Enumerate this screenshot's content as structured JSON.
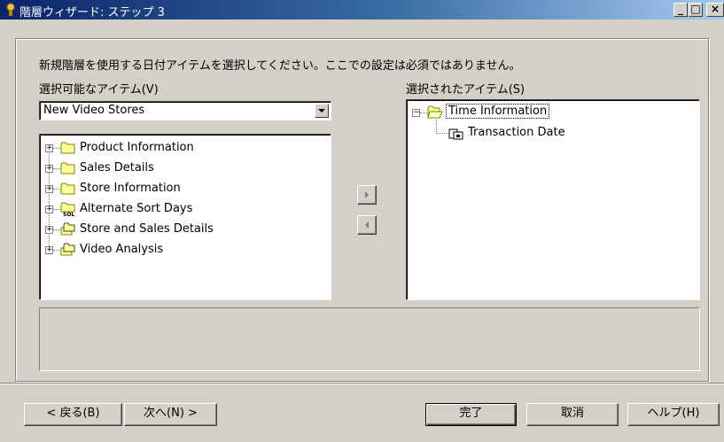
{
  "window": {
    "title": "階層ウィザード: ステップ 3",
    "minimize": "_",
    "maximize": "□",
    "close": "×"
  },
  "instruction": "新規階層を使用する日付アイテムを選択してください。ここでの設定は必須ではありません。",
  "available": {
    "label": "選択可能なアイテム(V)",
    "combo_value": "New Video Stores",
    "items": [
      {
        "label": "Product Information",
        "icon": "folder-icon"
      },
      {
        "label": "Sales Details",
        "icon": "folder-icon"
      },
      {
        "label": "Store Information",
        "icon": "folder-icon"
      },
      {
        "label": "Alternate Sort Days",
        "icon": "sql-folder-icon"
      },
      {
        "label": "Store and Sales Details",
        "icon": "complex-folder-icon"
      },
      {
        "label": "Video Analysis",
        "icon": "complex-folder-icon"
      }
    ]
  },
  "selected": {
    "label": "選択されたアイテム(S)",
    "items": [
      {
        "label": "Time Information",
        "icon": "open-folder-icon"
      },
      {
        "label": "Transaction Date",
        "icon": "date-item-icon"
      }
    ]
  },
  "buttons": {
    "back": "< 戻る(B)",
    "next": "次へ(N) >",
    "finish": "完了",
    "cancel": "取消",
    "help": "ヘルプ(H)"
  },
  "colors": {
    "title_start": "#0a246a",
    "title_end": "#a6caf0",
    "face": "#d4d0c8",
    "folder": "#ffff99"
  }
}
